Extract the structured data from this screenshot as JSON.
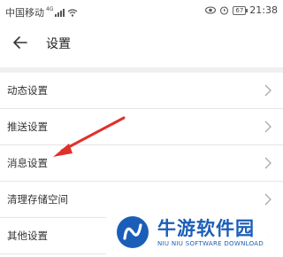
{
  "status_bar": {
    "carrier": "中国移动",
    "network": "4G",
    "time": "21:38",
    "battery": "67"
  },
  "header": {
    "title": "设置"
  },
  "settings_items": [
    {
      "label": "动态设置"
    },
    {
      "label": "推送设置"
    },
    {
      "label": "消息设置"
    },
    {
      "label": "清理存储空间"
    },
    {
      "label": "其他设置"
    }
  ],
  "watermark": {
    "title": "牛游软件园",
    "subtitle": "NIU NIU SOFTWARE DOWNLOAD"
  },
  "colors": {
    "annotation_arrow": "#e0302c",
    "watermark_blue": "#1a5eb8"
  },
  "icons": [
    "signal-icon",
    "wifi-icon",
    "eye-icon",
    "alarm-icon",
    "battery-icon",
    "back-arrow-icon",
    "chevron-right-icon"
  ]
}
